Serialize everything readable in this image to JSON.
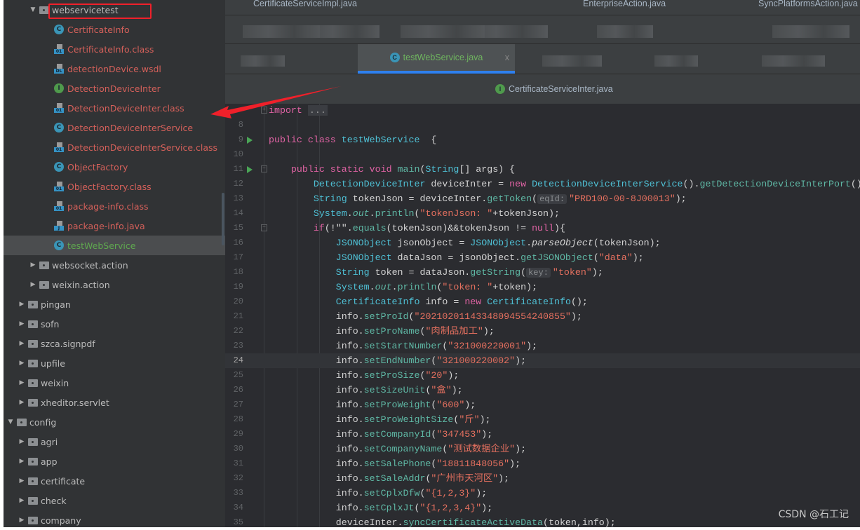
{
  "project_tree": [
    {
      "label": "webservicetest",
      "kind": "folder",
      "depth": 4,
      "state": "open",
      "highlighted": true
    },
    {
      "label": "CertificateInfo",
      "kind": "class",
      "depth": 5,
      "color": "#d4605a"
    },
    {
      "label": "CertificateInfo.class",
      "kind": "binary",
      "badge": "01",
      "depth": 5,
      "color": "#d4605a"
    },
    {
      "label": "detectionDevice.wsdl",
      "kind": "binary",
      "badge": "DL",
      "depth": 5,
      "color": "#d4605a"
    },
    {
      "label": "DetectionDeviceInter",
      "kind": "interface",
      "depth": 5,
      "color": "#d4605a"
    },
    {
      "label": "DetectionDeviceInter.class",
      "kind": "binary",
      "badge": "01",
      "depth": 5,
      "color": "#d4605a"
    },
    {
      "label": "DetectionDeviceInterService",
      "kind": "class",
      "depth": 5,
      "color": "#d4605a"
    },
    {
      "label": "DetectionDeviceInterService.class",
      "kind": "binary",
      "badge": "01",
      "depth": 5,
      "color": "#d4605a"
    },
    {
      "label": "ObjectFactory",
      "kind": "class",
      "depth": 5,
      "color": "#d4605a"
    },
    {
      "label": "ObjectFactory.class",
      "kind": "binary",
      "badge": "01",
      "depth": 5,
      "color": "#d4605a"
    },
    {
      "label": "package-info.class",
      "kind": "binary",
      "badge": "01",
      "depth": 5,
      "color": "#d4605a"
    },
    {
      "label": "package-info.java",
      "kind": "binary",
      "badge": "J",
      "depth": 5,
      "color": "#d4605a"
    },
    {
      "label": "testWebService",
      "kind": "class",
      "depth": 5,
      "color": "#5fa84f",
      "selected": true
    },
    {
      "label": "websocket.action",
      "kind": "folder",
      "depth": 4,
      "state": "closed"
    },
    {
      "label": "weixin.action",
      "kind": "folder",
      "depth": 4,
      "state": "closed"
    },
    {
      "label": "pingan",
      "kind": "folder",
      "depth": 3,
      "state": "closed"
    },
    {
      "label": "sofn",
      "kind": "folder",
      "depth": 3,
      "state": "closed"
    },
    {
      "label": "szca.signpdf",
      "kind": "folder",
      "depth": 3,
      "state": "closed"
    },
    {
      "label": "upfile",
      "kind": "folder",
      "depth": 3,
      "state": "closed"
    },
    {
      "label": "weixin",
      "kind": "folder",
      "depth": 3,
      "state": "closed"
    },
    {
      "label": "xheditor.servlet",
      "kind": "folder",
      "depth": 3,
      "state": "closed"
    },
    {
      "label": "config",
      "kind": "folder",
      "depth": 2,
      "state": "open"
    },
    {
      "label": "agri",
      "kind": "folder",
      "depth": 3,
      "state": "closed"
    },
    {
      "label": "app",
      "kind": "folder",
      "depth": 3,
      "state": "closed"
    },
    {
      "label": "certificate",
      "kind": "folder",
      "depth": 3,
      "state": "closed"
    },
    {
      "label": "check",
      "kind": "folder",
      "depth": 3,
      "state": "closed"
    },
    {
      "label": "company",
      "kind": "folder",
      "depth": 3,
      "state": "closed"
    }
  ],
  "tabs": {
    "row1": [
      "CertificateServiceImpl.java",
      "EnterpriseAction.java",
      "SyncPlatformsAction.java"
    ],
    "active": {
      "label": "testWebService.java",
      "close": "x"
    },
    "row4": {
      "label": "CertificateServiceInter.java",
      "icon": "interface-icon"
    }
  },
  "colors": {
    "accent": "#2f80ed",
    "keyword": "#e063a4",
    "type": "#4fc1d6",
    "method": "#5fb8a5",
    "string": "#e5705f",
    "annotation_arrow": "#f0202a"
  },
  "code": {
    "current_line": "24",
    "lines": [
      {
        "n": "",
        "fold": "+",
        "seg": [
          [
            "kw",
            "import "
          ],
          [
            "fold",
            "..."
          ]
        ]
      },
      {
        "n": "8",
        "seg": []
      },
      {
        "n": "9",
        "run": true,
        "seg": [
          [
            "kw",
            "public class "
          ],
          [
            "ty",
            "testWebService"
          ],
          [
            "",
            "  {"
          ]
        ]
      },
      {
        "n": "10",
        "seg": []
      },
      {
        "n": "11",
        "run": true,
        "fold": "-",
        "seg": [
          [
            "",
            "    "
          ],
          [
            "kw",
            "public static void "
          ],
          [
            "me",
            "main"
          ],
          [
            "",
            "("
          ],
          [
            "ty",
            "String"
          ],
          [
            "",
            "[] args) {"
          ]
        ]
      },
      {
        "n": "12",
        "seg": [
          [
            "",
            "        "
          ],
          [
            "ty",
            "DetectionDeviceInter"
          ],
          [
            "",
            " deviceInter = "
          ],
          [
            "kw",
            "new "
          ],
          [
            "ty",
            "DetectionDeviceInterService"
          ],
          [
            "",
            "()."
          ],
          [
            "me",
            "getDetectionDeviceInterPort"
          ],
          [
            "",
            "();"
          ]
        ]
      },
      {
        "n": "13",
        "seg": [
          [
            "",
            "        "
          ],
          [
            "ty",
            "String"
          ],
          [
            "",
            " tokenJson = deviceInter."
          ],
          [
            "me",
            "getToken"
          ],
          [
            "",
            "("
          ],
          [
            "hint",
            "eqId:"
          ],
          [
            "st",
            "\"PRD100-00-8J00013\""
          ],
          [
            "",
            ");"
          ]
        ]
      },
      {
        "n": "14",
        "seg": [
          [
            "",
            "        "
          ],
          [
            "ty",
            "System"
          ],
          [
            "",
            "."
          ],
          [
            "sf",
            "out"
          ],
          [
            "",
            "."
          ],
          [
            "me",
            "println"
          ],
          [
            "",
            "("
          ],
          [
            "st",
            "\"tokenJson: \""
          ],
          [
            "",
            "+tokenJson);"
          ]
        ]
      },
      {
        "n": "15",
        "fold": "-",
        "seg": [
          [
            "",
            "        "
          ],
          [
            "kw",
            "if"
          ],
          [
            "",
            "(!\"\"."
          ],
          [
            "me",
            "equals"
          ],
          [
            "",
            "(tokenJson)&&tokenJson != "
          ],
          [
            "kw",
            "null"
          ],
          [
            "",
            "){"
          ]
        ]
      },
      {
        "n": "16",
        "seg": [
          [
            "",
            "            "
          ],
          [
            "ty",
            "JSONObject"
          ],
          [
            "",
            " jsonObject = "
          ],
          [
            "ty",
            "JSONObject"
          ],
          [
            "",
            "."
          ],
          [
            "it",
            "parseObject"
          ],
          [
            "",
            "(tokenJson);"
          ]
        ]
      },
      {
        "n": "17",
        "seg": [
          [
            "",
            "            "
          ],
          [
            "ty",
            "JSONObject"
          ],
          [
            "",
            " dataJson = jsonObject."
          ],
          [
            "me",
            "getJSONObject"
          ],
          [
            "",
            "("
          ],
          [
            "st",
            "\"data\""
          ],
          [
            "",
            ");"
          ]
        ]
      },
      {
        "n": "18",
        "seg": [
          [
            "",
            "            "
          ],
          [
            "ty",
            "String"
          ],
          [
            "",
            " token = dataJson."
          ],
          [
            "me",
            "getString"
          ],
          [
            "",
            "("
          ],
          [
            "hint",
            "key:"
          ],
          [
            "st",
            "\"token\""
          ],
          [
            "",
            ");"
          ]
        ]
      },
      {
        "n": "19",
        "seg": [
          [
            "",
            "            "
          ],
          [
            "ty",
            "System"
          ],
          [
            "",
            "."
          ],
          [
            "sf",
            "out"
          ],
          [
            "",
            "."
          ],
          [
            "me",
            "println"
          ],
          [
            "",
            "("
          ],
          [
            "st",
            "\"token: \""
          ],
          [
            "",
            "+token);"
          ]
        ]
      },
      {
        "n": "20",
        "seg": [
          [
            "",
            "            "
          ],
          [
            "ty",
            "CertificateInfo"
          ],
          [
            "",
            " info = "
          ],
          [
            "kw",
            "new "
          ],
          [
            "ty",
            "CertificateInfo"
          ],
          [
            "",
            "();"
          ]
        ]
      },
      {
        "n": "21",
        "seg": [
          [
            "",
            "            info."
          ],
          [
            "me",
            "setProId"
          ],
          [
            "",
            "("
          ],
          [
            "st",
            "\"20210201143348094554240855\""
          ],
          [
            "",
            ");"
          ]
        ]
      },
      {
        "n": "22",
        "seg": [
          [
            "",
            "            info."
          ],
          [
            "me",
            "setProName"
          ],
          [
            "",
            "("
          ],
          [
            "st",
            "\"肉制品加工\""
          ],
          [
            "",
            ");"
          ]
        ]
      },
      {
        "n": "23",
        "seg": [
          [
            "",
            "            info."
          ],
          [
            "me",
            "setStartNumber"
          ],
          [
            "",
            "("
          ],
          [
            "st",
            "\"321000220001\""
          ],
          [
            "",
            ");"
          ]
        ]
      },
      {
        "n": "24",
        "seg": [
          [
            "",
            "            info."
          ],
          [
            "me",
            "setEndNumber"
          ],
          [
            "",
            "("
          ],
          [
            "st",
            "\"321000220002\""
          ],
          [
            "",
            ");"
          ]
        ]
      },
      {
        "n": "25",
        "seg": [
          [
            "",
            "            info."
          ],
          [
            "me",
            "setProSize"
          ],
          [
            "",
            "("
          ],
          [
            "st",
            "\"20\""
          ],
          [
            "",
            ");"
          ]
        ]
      },
      {
        "n": "26",
        "seg": [
          [
            "",
            "            info."
          ],
          [
            "me",
            "setSizeUnit"
          ],
          [
            "",
            "("
          ],
          [
            "st",
            "\"盒\""
          ],
          [
            "",
            ");"
          ]
        ]
      },
      {
        "n": "27",
        "seg": [
          [
            "",
            "            info."
          ],
          [
            "me",
            "setProWeight"
          ],
          [
            "",
            "("
          ],
          [
            "st",
            "\"600\""
          ],
          [
            "",
            ");"
          ]
        ]
      },
      {
        "n": "28",
        "seg": [
          [
            "",
            "            info."
          ],
          [
            "me",
            "setProWeightSize"
          ],
          [
            "",
            "("
          ],
          [
            "st",
            "\"斤\""
          ],
          [
            "",
            ");"
          ]
        ]
      },
      {
        "n": "29",
        "seg": [
          [
            "",
            "            info."
          ],
          [
            "me",
            "setCompanyId"
          ],
          [
            "",
            "("
          ],
          [
            "st",
            "\"347453\""
          ],
          [
            "",
            ");"
          ]
        ]
      },
      {
        "n": "30",
        "seg": [
          [
            "",
            "            info."
          ],
          [
            "me",
            "setCompanyName"
          ],
          [
            "",
            "("
          ],
          [
            "st",
            "\"测试数据企业\""
          ],
          [
            "",
            ");"
          ]
        ]
      },
      {
        "n": "31",
        "seg": [
          [
            "",
            "            info."
          ],
          [
            "me",
            "setSalePhone"
          ],
          [
            "",
            "("
          ],
          [
            "st",
            "\"18811848056\""
          ],
          [
            "",
            ");"
          ]
        ]
      },
      {
        "n": "32",
        "seg": [
          [
            "",
            "            info."
          ],
          [
            "me",
            "setSaleAddr"
          ],
          [
            "",
            "("
          ],
          [
            "st",
            "\"广州市天河区\""
          ],
          [
            "",
            ");"
          ]
        ]
      },
      {
        "n": "33",
        "seg": [
          [
            "",
            "            info."
          ],
          [
            "me",
            "setCplxDfw"
          ],
          [
            "",
            "("
          ],
          [
            "st",
            "\"{1,2,3}\""
          ],
          [
            "",
            ");"
          ]
        ]
      },
      {
        "n": "34",
        "seg": [
          [
            "",
            "            info."
          ],
          [
            "me",
            "setCplxJt"
          ],
          [
            "",
            "("
          ],
          [
            "st",
            "\"{1,2,3,4}\""
          ],
          [
            "",
            ");"
          ]
        ]
      },
      {
        "n": "35",
        "seg": [
          [
            "",
            "            deviceInter."
          ],
          [
            "me",
            "syncCertificateActiveData"
          ],
          [
            "",
            "(token,info);"
          ]
        ]
      }
    ]
  },
  "watermark": "CSDN @石工记"
}
